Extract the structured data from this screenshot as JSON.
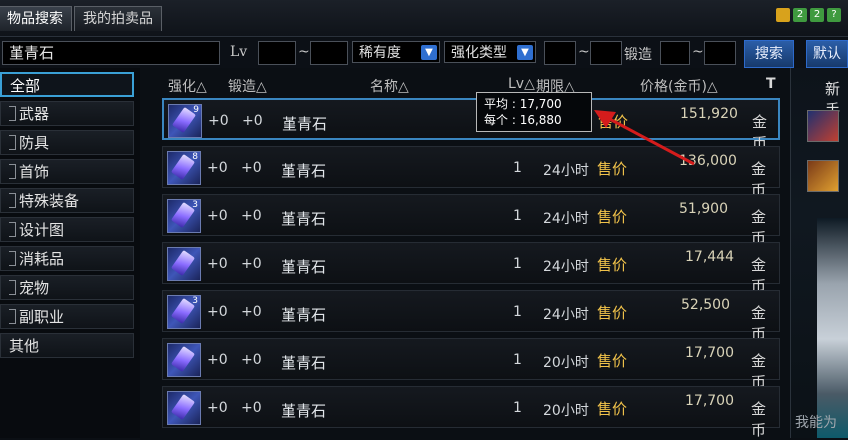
{
  "tabs": [
    {
      "label": "物品搜索"
    },
    {
      "label": "我的拍卖品"
    }
  ],
  "window_buttons": [
    "2",
    "2",
    "?"
  ],
  "search": {
    "name_value": "堇青石",
    "lv_label": "Lv",
    "range_sep": "~",
    "rarity_label": "稀有度",
    "enhance_type_label": "强化类型",
    "forge_label": "锻造",
    "search_button": "搜索",
    "default_button": "默认"
  },
  "categories": [
    {
      "label": "全部",
      "selected": true
    },
    {
      "label": "武器"
    },
    {
      "label": "防具"
    },
    {
      "label": "首饰"
    },
    {
      "label": "特殊装备"
    },
    {
      "label": "设计图"
    },
    {
      "label": "消耗品"
    },
    {
      "label": "宠物"
    },
    {
      "label": "副职业"
    },
    {
      "label": "其他"
    }
  ],
  "columns": {
    "enhance": "强化△",
    "forge": "锻造△",
    "name": "名称△",
    "lv": "Lv△",
    "period": "期限△",
    "price": "价格(金币)△",
    "pin": "T"
  },
  "tooltip": {
    "avg_label": "平均",
    "avg_value": ": 17,700",
    "each_label": "每个",
    "each_value": ": 16,880"
  },
  "rows": [
    {
      "qty": "9",
      "enhance": "+0",
      "forge": "+0",
      "name": "堇青石",
      "lv": "",
      "period": "",
      "sell": "售价",
      "price": "151,920",
      "coin": "金币"
    },
    {
      "qty": "8",
      "enhance": "+0",
      "forge": "+0",
      "name": "堇青石",
      "lv": "1",
      "period": "24小时",
      "sell": "售价",
      "price": "136,000",
      "coin": "金币"
    },
    {
      "qty": "3",
      "enhance": "+0",
      "forge": "+0",
      "name": "堇青石",
      "lv": "1",
      "period": "24小时",
      "sell": "售价",
      "price": "51,900",
      "coin": "金币"
    },
    {
      "qty": "",
      "enhance": "+0",
      "forge": "+0",
      "name": "堇青石",
      "lv": "1",
      "period": "24小时",
      "sell": "售价",
      "price": "17,444",
      "coin": "金币"
    },
    {
      "qty": "3",
      "enhance": "+0",
      "forge": "+0",
      "name": "堇青石",
      "lv": "1",
      "period": "24小时",
      "sell": "售价",
      "price": "52,500",
      "coin": "金币"
    },
    {
      "qty": "",
      "enhance": "+0",
      "forge": "+0",
      "name": "堇青石",
      "lv": "1",
      "period": "20小时",
      "sell": "售价",
      "price": "17,700",
      "coin": "金币"
    },
    {
      "qty": "",
      "enhance": "+0",
      "forge": "+0",
      "name": "堇青石",
      "lv": "1",
      "period": "20小时",
      "sell": "售价",
      "price": "17,700",
      "coin": "金币"
    }
  ],
  "right_panel": {
    "title": "新手",
    "bottom_text": "我能为"
  }
}
